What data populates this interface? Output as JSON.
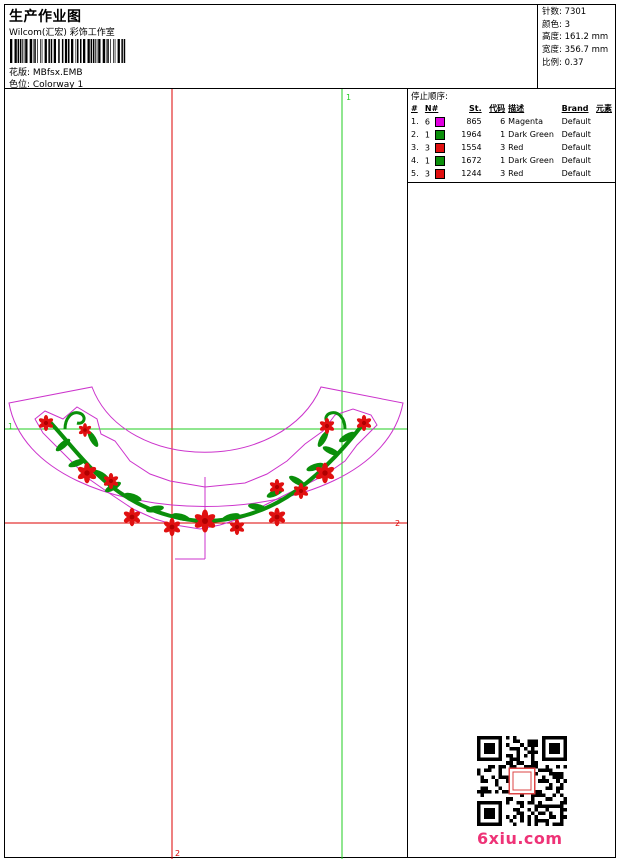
{
  "header": {
    "title": "生产作业图",
    "subtitle": "Wilcom(汇宏) 彩饰工作室",
    "design_file": "花版:  MBfsx.EMB",
    "colorway": "色位:  Colorway 1"
  },
  "stats": [
    {
      "label": "针数:",
      "value": "7301"
    },
    {
      "label": "颜色:",
      "value": "3"
    },
    {
      "label": "高度:",
      "value": "161.2 mm"
    },
    {
      "label": "宽度:",
      "value": "356.7 mm"
    },
    {
      "label": "比例:",
      "value": "0.37"
    }
  ],
  "stop_sequence": {
    "heading": "停止顺序:",
    "columns": [
      "#",
      "N#",
      "St.",
      "代码",
      "描述",
      "Brand",
      "元素"
    ],
    "rows": [
      {
        "idx": "1.",
        "n": "6",
        "color": "#e000e0",
        "st": "865",
        "code": "6",
        "desc": "Magenta",
        "brand": "Default"
      },
      {
        "idx": "2.",
        "n": "1",
        "color": "#0a8f0a",
        "st": "1964",
        "code": "1",
        "desc": "Dark Green",
        "brand": "Default"
      },
      {
        "idx": "3.",
        "n": "3",
        "color": "#e01010",
        "st": "1554",
        "code": "3",
        "desc": "Red",
        "brand": "Default"
      },
      {
        "idx": "4.",
        "n": "1",
        "color": "#0a8f0a",
        "st": "1672",
        "code": "1",
        "desc": "Dark Green",
        "brand": "Default"
      },
      {
        "idx": "5.",
        "n": "3",
        "color": "#e01010",
        "st": "1244",
        "code": "3",
        "desc": "Red",
        "brand": "Default"
      }
    ]
  },
  "axes": {
    "red_label_h": "2",
    "red_label_v": "2",
    "green_label_h": "1",
    "green_label_v": "1"
  },
  "colors": {
    "outline": "#cc33cc",
    "red_guide": "#dd0000",
    "green_guide": "#22cc22",
    "vine": "#0a8f0a",
    "flower": "#e01010"
  },
  "watermark": "6xiu.com"
}
